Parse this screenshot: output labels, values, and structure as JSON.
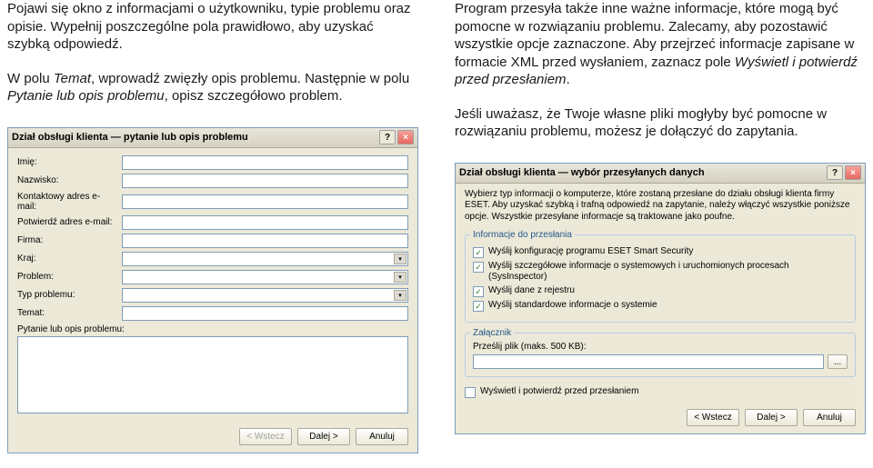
{
  "left": {
    "para1": "Pojawi się okno z informacjami o użytkowniku, typie problemu oraz opisie. Wypełnij poszczególne pola prawidłowo, aby uzyskać szybką odpowiedź.",
    "para2a": "W polu ",
    "para2b": "Temat",
    "para2c": ", wprowadź zwięzły opis problemu. Następnie w polu ",
    "para2d": "Pytanie lub opis problemu",
    "para2e": ", opisz szczegółowo problem.",
    "dialog": {
      "title": "Dział obsługi klienta — pytanie lub opis problemu",
      "rows": {
        "imie": "Imię:",
        "nazwisko": "Nazwisko:",
        "email": "Kontaktowy adres e-mail:",
        "email2": "Potwierdź adres e-mail:",
        "firma": "Firma:",
        "kraj": "Kraj:",
        "problem": "Problem:",
        "typ": "Typ problemu:",
        "temat": "Temat:",
        "pytanie": "Pytanie lub opis problemu:"
      },
      "buttons": {
        "wstecz": "< Wstecz",
        "dalej": "Dalej >",
        "anuluj": "Anuluj"
      }
    }
  },
  "right": {
    "para1a": "Program przesyła także inne ważne informacje, które mogą być pomocne w rozwiązaniu problemu. Zalecamy, aby pozostawić wszystkie opcje zaznaczone. Aby przejrzeć informacje zapisane w formacie XML przed wysłaniem, zaznacz pole ",
    "para1b": "Wyświetl i potwierdź przed przesłaniem",
    "para1c": ".",
    "para2": "Jeśli uważasz, że Twoje własne pliki mogłyby być pomocne w rozwiązaniu problemu, możesz je dołączyć do zapytania.",
    "dialog": {
      "title": "Dział obsługi klienta — wybór przesyłanych danych",
      "info": "Wybierz typ informacji o komputerze, które zostaną przesłane do działu obsługi klienta firmy ESET. Aby uzyskać szybką i trafną odpowiedź na zapytanie, należy włączyć wszystkie poniższe opcje. Wszystkie przesyłane informacje są traktowane jako poufne.",
      "fieldset1_legend": "Informacje do przesłania",
      "check1": "Wyślij konfigurację programu ESET Smart Security",
      "check2": "Wyślij szczegółowe informacje o systemowych i uruchomionych procesach (SysInspector)",
      "check3": "Wyślij dane z rejestru",
      "check4": "Wyślij standardowe informacje o systemie",
      "fieldset2_legend": "Załącznik",
      "file_label": "Prześlij plik (maks. 500 KB):",
      "confirm": "Wyświetl i potwierdź przed przesłaniem",
      "buttons": {
        "wstecz": "< Wstecz",
        "dalej": "Dalej >",
        "anuluj": "Anuluj"
      }
    }
  }
}
